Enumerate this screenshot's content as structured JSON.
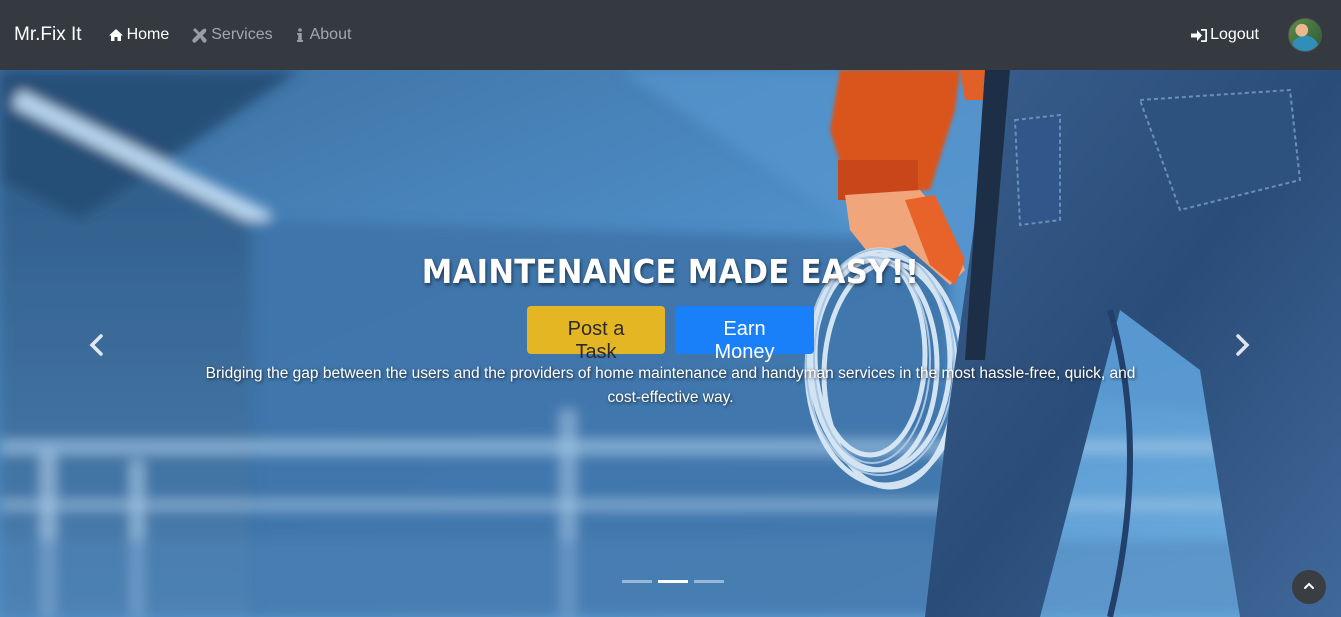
{
  "navbar": {
    "brand": "Mr.Fix It",
    "items": [
      {
        "label": "Home",
        "icon": "home-icon",
        "active": true
      },
      {
        "label": "Services",
        "icon": "tools-icon",
        "active": false
      },
      {
        "label": "About",
        "icon": "info-icon",
        "active": false
      }
    ],
    "logout_label": "Logout",
    "logout_icon": "sign-in-icon"
  },
  "hero": {
    "title": "MAINTENANCE MADE EASY!!",
    "post_task_label": "Post a Task",
    "earn_money_label": "Earn Money",
    "description": "Bridging the gap between the users and the providers of home maintenance and handyman services in the most hassle-free, quick, and cost-effective way.",
    "active_slide": 2,
    "slide_count": 3
  },
  "colors": {
    "navbar_bg": "#343a40",
    "post_button": "#e5b624",
    "earn_button": "#1a80fa"
  }
}
